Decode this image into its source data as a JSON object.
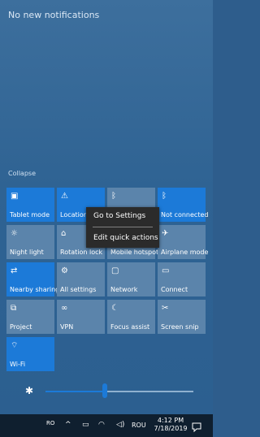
{
  "notifications": {
    "empty_text": "No new notifications"
  },
  "collapse_label": "Collapse",
  "tiles": [
    {
      "label": "Tablet mode",
      "icon": "tablet-mode-icon",
      "state": "on"
    },
    {
      "label": "Location",
      "icon": "location-icon",
      "state": "on"
    },
    {
      "label": "",
      "icon": "bluetooth-icon",
      "state": "off"
    },
    {
      "label": "Not connected",
      "icon": "bluetooth-icon",
      "state": "on"
    },
    {
      "label": "Night light",
      "icon": "night-light-icon",
      "state": "off"
    },
    {
      "label": "Rotation lock",
      "icon": "rotation-lock-icon",
      "state": "off"
    },
    {
      "label": "Mobile hotspot",
      "icon": "mobile-hotspot-icon",
      "state": "off"
    },
    {
      "label": "Airplane mode",
      "icon": "airplane-icon",
      "state": "off"
    },
    {
      "label": "Nearby sharing",
      "icon": "nearby-sharing-icon",
      "state": "on"
    },
    {
      "label": "All settings",
      "icon": "settings-icon",
      "state": "off"
    },
    {
      "label": "Network",
      "icon": "network-icon",
      "state": "off"
    },
    {
      "label": "Connect",
      "icon": "connect-icon",
      "state": "off"
    },
    {
      "label": "Project",
      "icon": "project-icon",
      "state": "off"
    },
    {
      "label": "VPN",
      "icon": "vpn-icon",
      "state": "off"
    },
    {
      "label": "Focus assist",
      "icon": "focus-assist-icon",
      "state": "off"
    },
    {
      "label": "Screen snip",
      "icon": "screen-snip-icon",
      "state": "off"
    },
    {
      "label": "Wi-Fi",
      "icon": "wifi-icon",
      "state": "on"
    }
  ],
  "context_menu": {
    "items": [
      "Go to Settings",
      "Edit quick actions"
    ]
  },
  "brightness": {
    "value_fraction": 0.4
  },
  "taskbar": {
    "lang_small": "RO",
    "lang": "ROU",
    "time": "4:12 PM",
    "date": "7/18/2019"
  },
  "colors": {
    "tile_on": "#1c7ad8",
    "tile_off": "#5b84ab",
    "taskbar": "#0f1f2f"
  }
}
